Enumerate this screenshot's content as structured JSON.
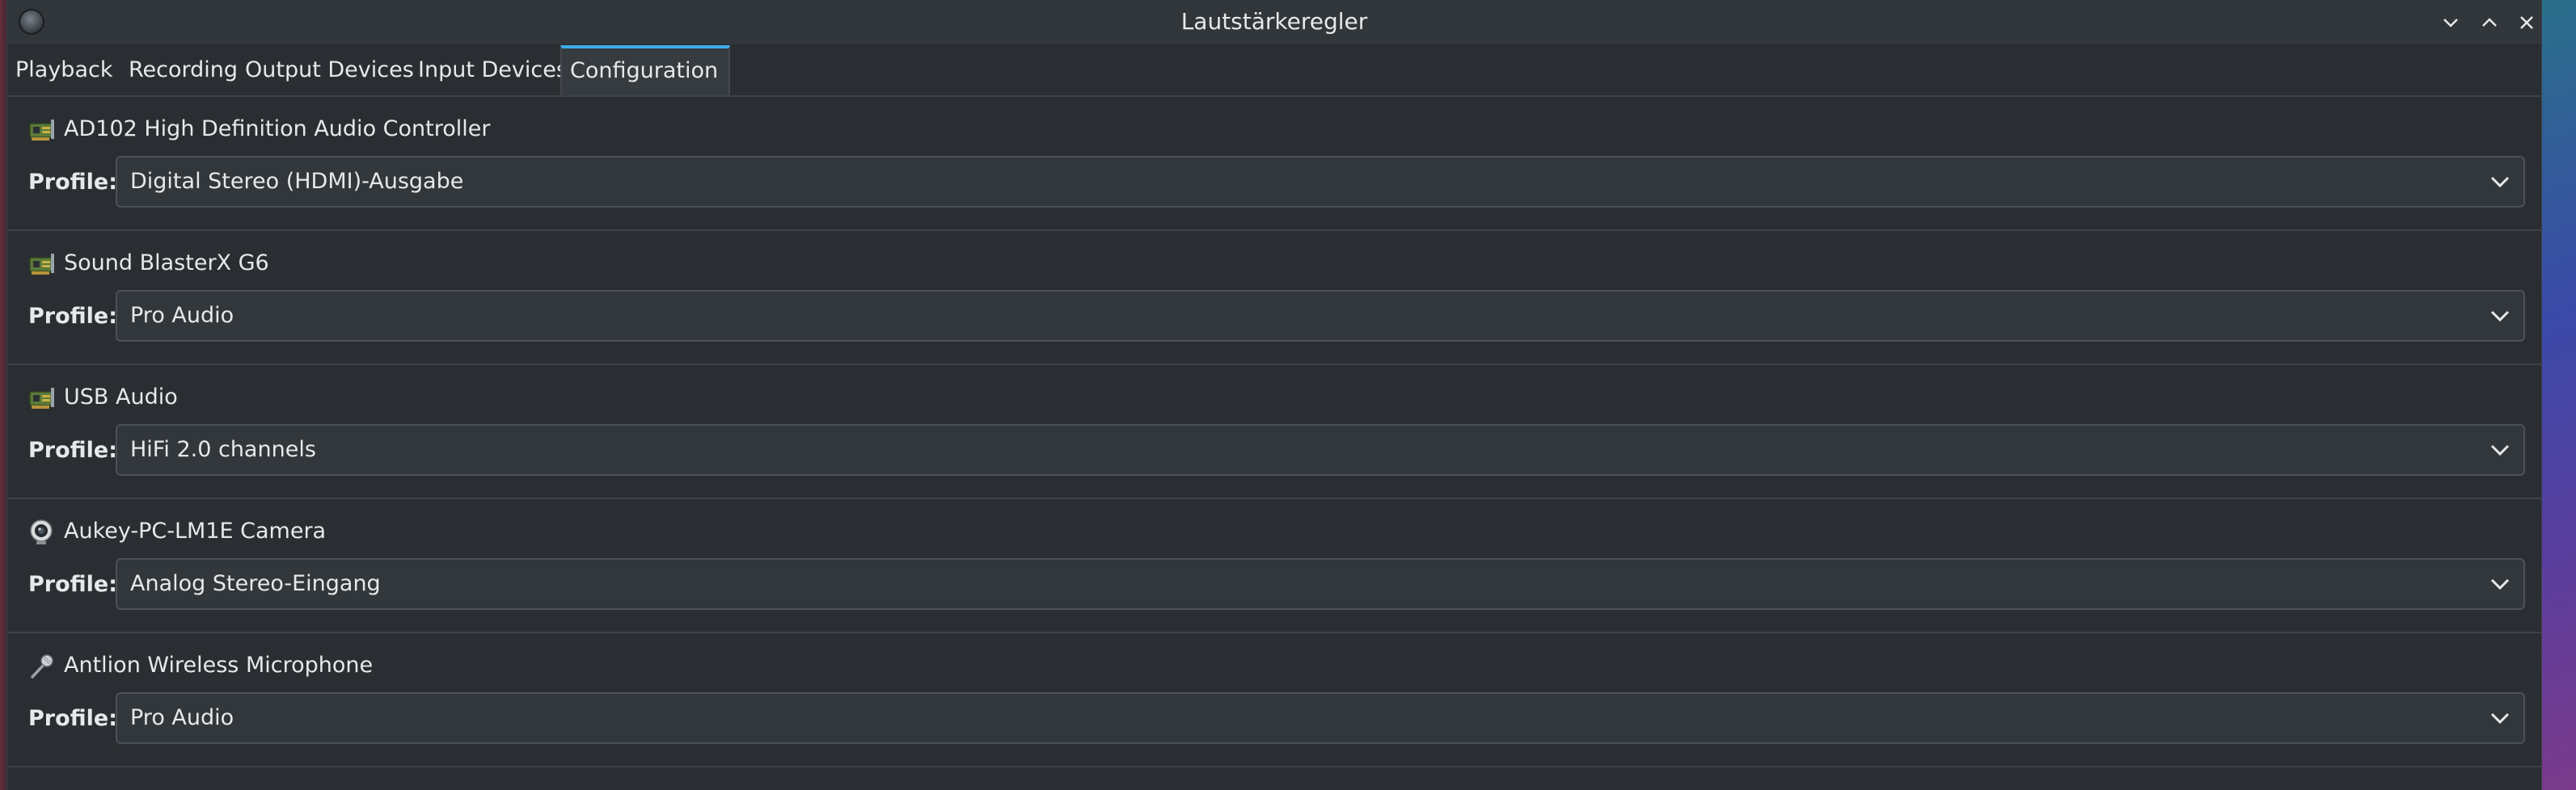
{
  "window": {
    "title": "Lautstärkeregler",
    "app_icon": "pavucontrol-app-icon",
    "controls": [
      "minimize-icon",
      "maximize-icon",
      "close-icon"
    ]
  },
  "tabs": [
    {
      "label": "Playback",
      "active": false
    },
    {
      "label": "Recording",
      "active": false
    },
    {
      "label": "Output Devices",
      "active": false
    },
    {
      "label": "Input Devices",
      "active": false
    },
    {
      "label": "Configuration",
      "active": true
    }
  ],
  "profile_label": "Profile:",
  "cards": [
    {
      "name": "AD102 High Definition Audio Controller",
      "icon": "sound-card-icon",
      "profile": "Digital Stereo (HDMI)-Ausgabe"
    },
    {
      "name": "Sound BlasterX G6",
      "icon": "sound-card-icon",
      "profile": "Pro Audio"
    },
    {
      "name": "USB Audio",
      "icon": "sound-card-icon",
      "profile": "HiFi 2.0 channels"
    },
    {
      "name": "Aukey-PC-LM1E Camera",
      "icon": "webcam-icon",
      "profile": "Analog Stereo-Eingang"
    },
    {
      "name": "Antlion Wireless Microphone",
      "icon": "microphone-icon",
      "profile": "Pro Audio"
    }
  ],
  "colors": {
    "accent": "#3daee9",
    "window_bg": "#2a2e32",
    "combo_bg": "#32373c"
  }
}
